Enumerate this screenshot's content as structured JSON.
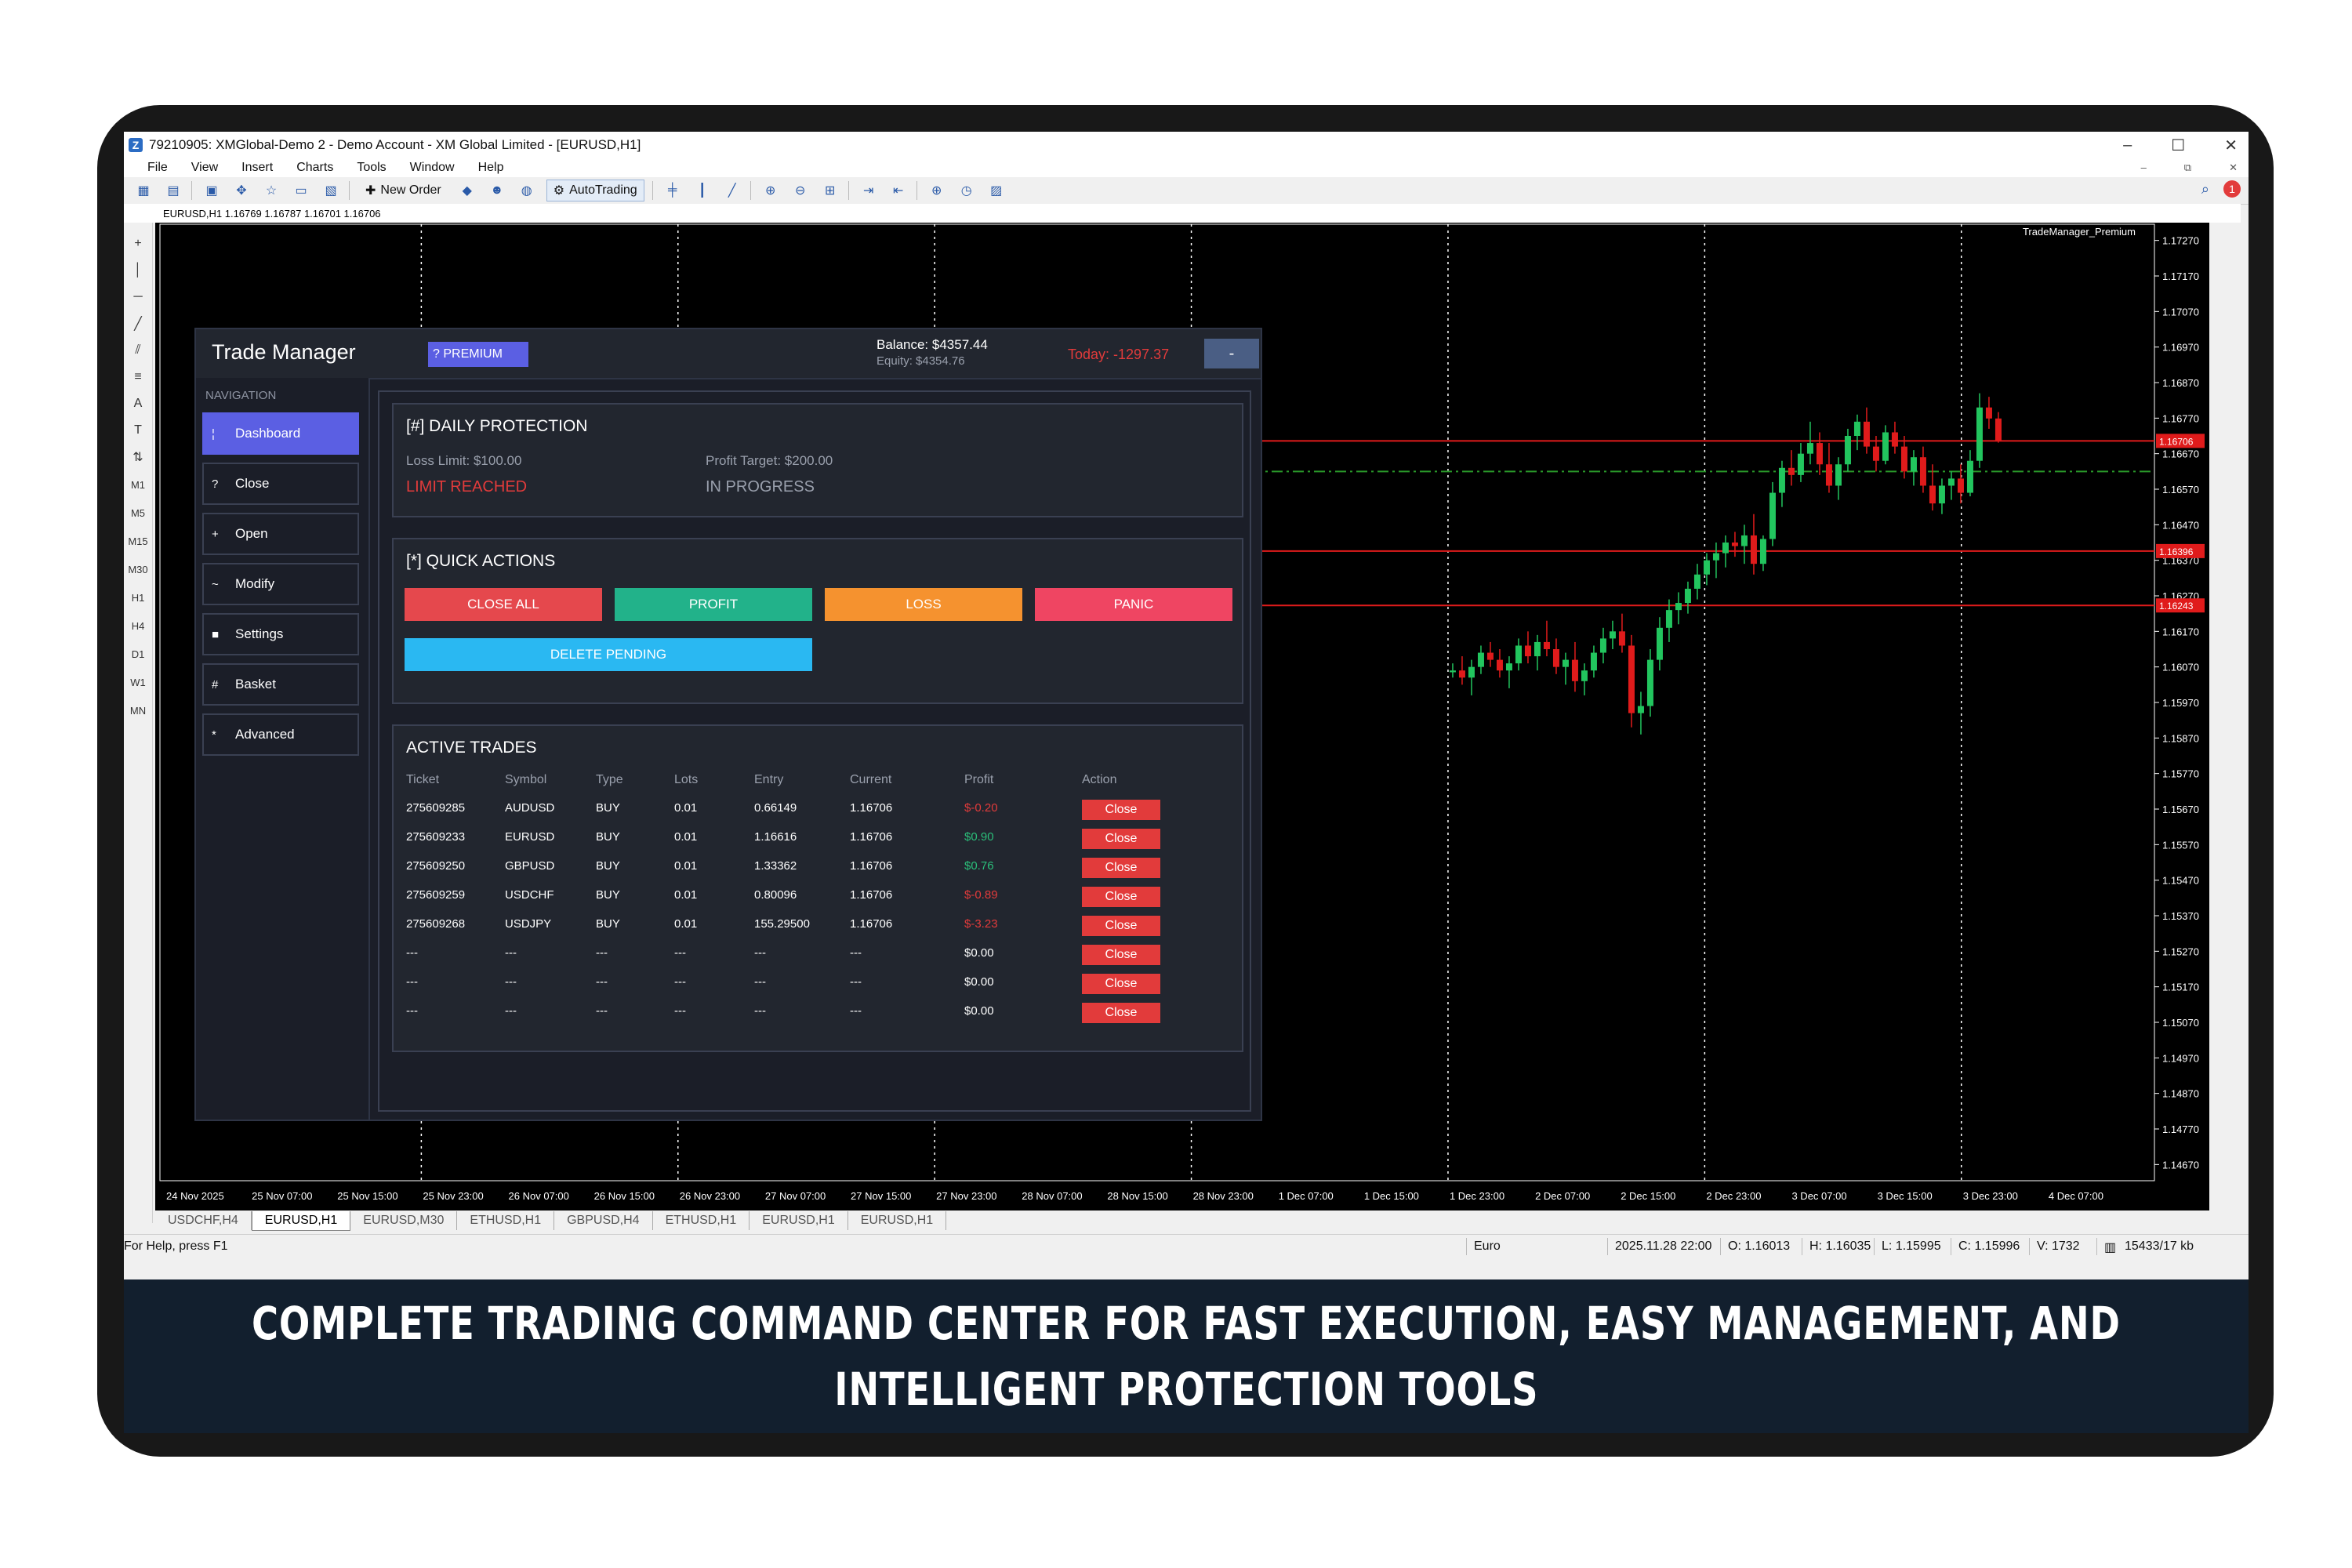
{
  "window": {
    "title": "79210905: XMGlobal-Demo 2 - Demo Account - XM Global Limited - [EURUSD,H1]",
    "controls": [
      "–",
      "☐",
      "✕"
    ],
    "mdi_controls": [
      "–",
      "⧉",
      "✕"
    ]
  },
  "menu": [
    "File",
    "View",
    "Insert",
    "Charts",
    "Tools",
    "Window",
    "Help"
  ],
  "toolbar": {
    "new_order": "New Order",
    "autotrading": "AutoTrading",
    "notification_count": "1"
  },
  "left_tools": {
    "timeframes": [
      "M1",
      "M5",
      "M15",
      "M30",
      "H1",
      "H4",
      "D1",
      "W1",
      "MN"
    ]
  },
  "chart": {
    "header": "EURUSD,H1  1.16769 1.16787 1.16701 1.16706",
    "indicator_name": "TradeManager_Premium"
  },
  "chart_data": {
    "type": "candlestick",
    "symbol": "EURUSD",
    "timeframe": "H1",
    "ohlc_header": {
      "open": 1.16769,
      "high": 1.16787,
      "low": 1.16701,
      "close": 1.16706
    },
    "ylim": [
      1.1462,
      1.1732
    ],
    "y_ticks": [
      1.1727,
      1.1717,
      1.1707,
      1.1697,
      1.1687,
      1.1677,
      1.1667,
      1.1657,
      1.1647,
      1.1637,
      1.1627,
      1.1617,
      1.1607,
      1.1597,
      1.1587,
      1.1577,
      1.1567,
      1.1557,
      1.1547,
      1.1537,
      1.1527,
      1.1517,
      1.1507,
      1.1497,
      1.1487,
      1.1477,
      1.1467
    ],
    "x_ticks": [
      "24 Nov 2025",
      "25 Nov 07:00",
      "25 Nov 15:00",
      "25 Nov 23:00",
      "26 Nov 07:00",
      "26 Nov 15:00",
      "26 Nov 23:00",
      "27 Nov 07:00",
      "27 Nov 15:00",
      "27 Nov 23:00",
      "28 Nov 07:00",
      "28 Nov 15:00",
      "28 Nov 23:00",
      "1 Dec 07:00",
      "1 Dec 15:00",
      "1 Dec 23:00",
      "2 Dec 07:00",
      "2 Dec 15:00",
      "2 Dec 23:00",
      "3 Dec 07:00",
      "3 Dec 15:00",
      "3 Dec 23:00",
      "4 Dec 07:00"
    ],
    "horizontal_levels": [
      {
        "price": 1.16706,
        "color": "#e01b1b",
        "style": "solid"
      },
      {
        "price": 1.16396,
        "color": "#e01b1b",
        "style": "solid"
      },
      {
        "price": 1.16243,
        "color": "#e01b1b",
        "style": "solid"
      },
      {
        "price": 1.1662,
        "color": "#2a9a2a",
        "style": "dashdot"
      }
    ],
    "candle_start_session": "1 Dec 23:00",
    "candles": [
      [
        1.16055,
        1.1608,
        1.1604,
        1.1606
      ],
      [
        1.1606,
        1.161,
        1.1602,
        1.1604
      ],
      [
        1.1604,
        1.1609,
        1.1599,
        1.1607
      ],
      [
        1.1607,
        1.1613,
        1.1605,
        1.1611
      ],
      [
        1.1611,
        1.1614,
        1.1607,
        1.1609
      ],
      [
        1.1609,
        1.1612,
        1.1604,
        1.1606
      ],
      [
        1.1606,
        1.161,
        1.1601,
        1.1608
      ],
      [
        1.1608,
        1.1615,
        1.1606,
        1.1613
      ],
      [
        1.1613,
        1.1617,
        1.1608,
        1.161
      ],
      [
        1.161,
        1.1616,
        1.1606,
        1.1614
      ],
      [
        1.1614,
        1.162,
        1.161,
        1.1612
      ],
      [
        1.1612,
        1.1615,
        1.1605,
        1.1607
      ],
      [
        1.1607,
        1.1611,
        1.1602,
        1.1609
      ],
      [
        1.1609,
        1.1614,
        1.16,
        1.1603
      ],
      [
        1.1603,
        1.1608,
        1.1599,
        1.1606
      ],
      [
        1.1606,
        1.1613,
        1.1604,
        1.1611
      ],
      [
        1.1611,
        1.1618,
        1.1608,
        1.1615
      ],
      [
        1.1615,
        1.162,
        1.1612,
        1.1617
      ],
      [
        1.1617,
        1.1622,
        1.1611,
        1.1613
      ],
      [
        1.1613,
        1.1616,
        1.159,
        1.1594
      ],
      [
        1.1594,
        1.16,
        1.1588,
        1.1596
      ],
      [
        1.1596,
        1.1612,
        1.1593,
        1.1609
      ],
      [
        1.1609,
        1.1621,
        1.1606,
        1.1618
      ],
      [
        1.1618,
        1.1626,
        1.1614,
        1.1623
      ],
      [
        1.1623,
        1.1628,
        1.1619,
        1.1625
      ],
      [
        1.1625,
        1.1631,
        1.1622,
        1.1629
      ],
      [
        1.1629,
        1.1636,
        1.1626,
        1.1633
      ],
      [
        1.1633,
        1.1639,
        1.163,
        1.1637
      ],
      [
        1.1637,
        1.1642,
        1.1632,
        1.1639
      ],
      [
        1.1639,
        1.1644,
        1.1635,
        1.1642
      ],
      [
        1.1642,
        1.1645,
        1.1638,
        1.1641
      ],
      [
        1.1641,
        1.1647,
        1.1636,
        1.1644
      ],
      [
        1.1644,
        1.165,
        1.1633,
        1.1636
      ],
      [
        1.1636,
        1.1644,
        1.1634,
        1.1643
      ],
      [
        1.1643,
        1.1659,
        1.1641,
        1.1656
      ],
      [
        1.1656,
        1.1665,
        1.1652,
        1.1663
      ],
      [
        1.1663,
        1.1668,
        1.1658,
        1.1661
      ],
      [
        1.1661,
        1.167,
        1.1659,
        1.1667
      ],
      [
        1.1667,
        1.1676,
        1.1664,
        1.167
      ],
      [
        1.167,
        1.1673,
        1.1661,
        1.1664
      ],
      [
        1.1664,
        1.167,
        1.1656,
        1.1658
      ],
      [
        1.1658,
        1.1666,
        1.1654,
        1.1664
      ],
      [
        1.1664,
        1.1674,
        1.1662,
        1.1672
      ],
      [
        1.1672,
        1.1678,
        1.1668,
        1.1676
      ],
      [
        1.1676,
        1.168,
        1.1667,
        1.1669
      ],
      [
        1.1669,
        1.1672,
        1.1662,
        1.1665
      ],
      [
        1.1665,
        1.1675,
        1.1664,
        1.1673
      ],
      [
        1.1673,
        1.1676,
        1.1667,
        1.1669
      ],
      [
        1.1669,
        1.1672,
        1.166,
        1.1662
      ],
      [
        1.1662,
        1.1668,
        1.1658,
        1.1666
      ],
      [
        1.1666,
        1.1669,
        1.1656,
        1.1658
      ],
      [
        1.1658,
        1.1664,
        1.1651,
        1.1653
      ],
      [
        1.1653,
        1.166,
        1.165,
        1.1658
      ],
      [
        1.1658,
        1.1662,
        1.1654,
        1.166
      ],
      [
        1.166,
        1.1664,
        1.1653,
        1.1656
      ],
      [
        1.1656,
        1.1668,
        1.1655,
        1.1665
      ],
      [
        1.1665,
        1.1684,
        1.1663,
        1.168
      ],
      [
        1.168,
        1.1683,
        1.1674,
        1.16769
      ],
      [
        1.16769,
        1.16787,
        1.16701,
        1.16706
      ]
    ]
  },
  "trade_manager": {
    "title": "Trade Manager",
    "badge": "? PREMIUM",
    "balance": "Balance: $4357.44",
    "equity": "Equity: $4354.76",
    "today": "Today: -1297.37",
    "minimize": "-",
    "nav_heading": "NAVIGATION",
    "nav": [
      {
        "icon": "¦",
        "label": "Dashboard",
        "active": true
      },
      {
        "icon": "?",
        "label": "Close"
      },
      {
        "icon": "+",
        "label": "Open"
      },
      {
        "icon": "~",
        "label": "Modify"
      },
      {
        "icon": "■",
        "label": "Settings"
      },
      {
        "icon": "#",
        "label": "Basket"
      },
      {
        "icon": "*",
        "label": "Advanced"
      }
    ],
    "daily_protection": {
      "title": "[#] DAILY PROTECTION",
      "loss_limit": "Loss Limit: $100.00",
      "loss_status": "LIMIT REACHED",
      "profit_target": "Profit Target: $200.00",
      "profit_status": "IN PROGRESS"
    },
    "quick_actions": {
      "title": "[*] QUICK ACTIONS",
      "close_all": "CLOSE ALL",
      "profit": "PROFIT",
      "loss": "LOSS",
      "panic": "PANIC",
      "delete_pending": "DELETE PENDING"
    },
    "active_trades": {
      "title": "ACTIVE TRADES",
      "headers": [
        "Ticket",
        "Symbol",
        "Type",
        "Lots",
        "Entry",
        "Current",
        "Profit",
        "Action"
      ],
      "rows": [
        {
          "ticket": "275609285",
          "symbol": "AUDUSD",
          "type": "BUY",
          "lots": "0.01",
          "entry": "0.66149",
          "current": "1.16706",
          "profit": "$-0.20",
          "action": "Close"
        },
        {
          "ticket": "275609233",
          "symbol": "EURUSD",
          "type": "BUY",
          "lots": "0.01",
          "entry": "1.16616",
          "current": "1.16706",
          "profit": "$0.90",
          "action": "Close"
        },
        {
          "ticket": "275609250",
          "symbol": "GBPUSD",
          "type": "BUY",
          "lots": "0.01",
          "entry": "1.33362",
          "current": "1.16706",
          "profit": "$0.76",
          "action": "Close"
        },
        {
          "ticket": "275609259",
          "symbol": "USDCHF",
          "type": "BUY",
          "lots": "0.01",
          "entry": "0.80096",
          "current": "1.16706",
          "profit": "$-0.89",
          "action": "Close"
        },
        {
          "ticket": "275609268",
          "symbol": "USDJPY",
          "type": "BUY",
          "lots": "0.01",
          "entry": "155.29500",
          "current": "1.16706",
          "profit": "$-3.23",
          "action": "Close"
        },
        {
          "ticket": "---",
          "symbol": "---",
          "type": "---",
          "lots": "---",
          "entry": "---",
          "current": "---",
          "profit": "$0.00",
          "action": "Close"
        },
        {
          "ticket": "---",
          "symbol": "---",
          "type": "---",
          "lots": "---",
          "entry": "---",
          "current": "---",
          "profit": "$0.00",
          "action": "Close"
        },
        {
          "ticket": "---",
          "symbol": "---",
          "type": "---",
          "lots": "---",
          "entry": "---",
          "current": "---",
          "profit": "$0.00",
          "action": "Close"
        }
      ]
    }
  },
  "tabs": [
    "USDCHF,H4",
    "EURUSD,H1",
    "EURUSD,M30",
    "ETHUSD,H1",
    "GBPUSD,H4",
    "ETHUSD,H1",
    "EURUSD,H1",
    "EURUSD,H1"
  ],
  "active_tab": 1,
  "status": {
    "help": "For Help, press F1",
    "profile": "Euro",
    "datetime": "2025.11.28 22:00",
    "open": "O: 1.16013",
    "high": "H: 1.16035",
    "low": "L: 1.15995",
    "close": "C: 1.15996",
    "volume": "V: 1732",
    "traffic": "15433/17 kb"
  },
  "footer": {
    "line1": "COMPLETE TRADING COMMAND CENTER FOR FAST EXECUTION, EASY MANAGEMENT, AND",
    "line2": "INTELLIGENT PROTECTION TOOLS"
  },
  "colors": {
    "accent": "#5b5fe3",
    "close_all": "#e5484d",
    "profit": "#22b28a",
    "loss": "#f5922f",
    "panic": "#ef4562",
    "delete_pending": "#2ab8f2",
    "bull_candle": "#22c55e",
    "bear_candle": "#e01b1b"
  }
}
